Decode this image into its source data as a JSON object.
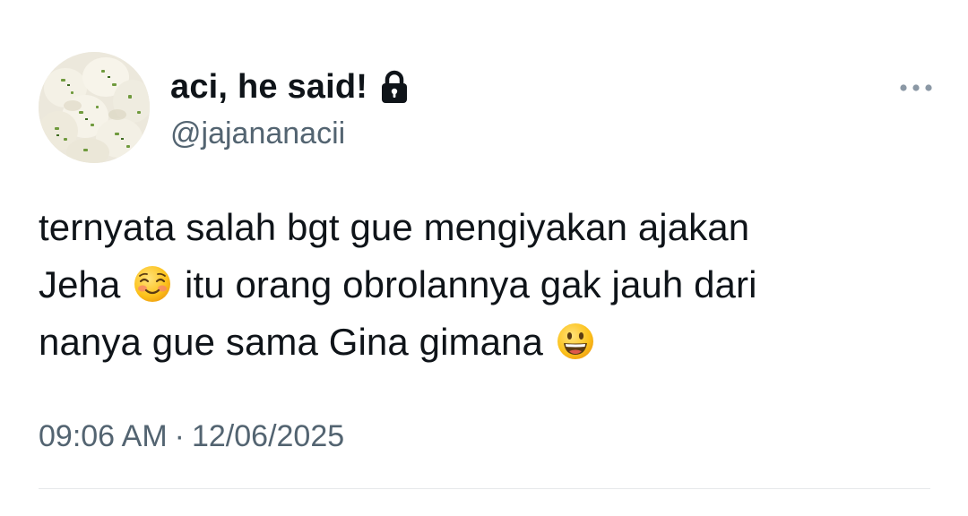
{
  "author": {
    "display_name": "aci, he said!",
    "handle": "@jajananacii",
    "avatar_icon": "avatar-photo",
    "protected_icon": "lock-icon"
  },
  "menu": {
    "icon": "more-horizontal-icon"
  },
  "tweet": {
    "lines": [
      {
        "text_before": "ternyata salah bgt gue mengiyakan ajakan",
        "emoji": null,
        "text_after": ""
      },
      {
        "text_before": "Jeha ",
        "emoji": "smiling-face-emoji",
        "text_after": " itu orang obrolannya gak jauh dari"
      },
      {
        "text_before": "nanya gue sama Gina gimana ",
        "emoji": "grinning-face-emoji",
        "text_after": ""
      }
    ]
  },
  "meta": {
    "time": "09:06 AM",
    "separator": "·",
    "date": "12/06/2025"
  },
  "colors": {
    "text_primary": "#0f1419",
    "text_secondary": "#536471",
    "divider": "#e6e8ea",
    "background": "#ffffff"
  }
}
